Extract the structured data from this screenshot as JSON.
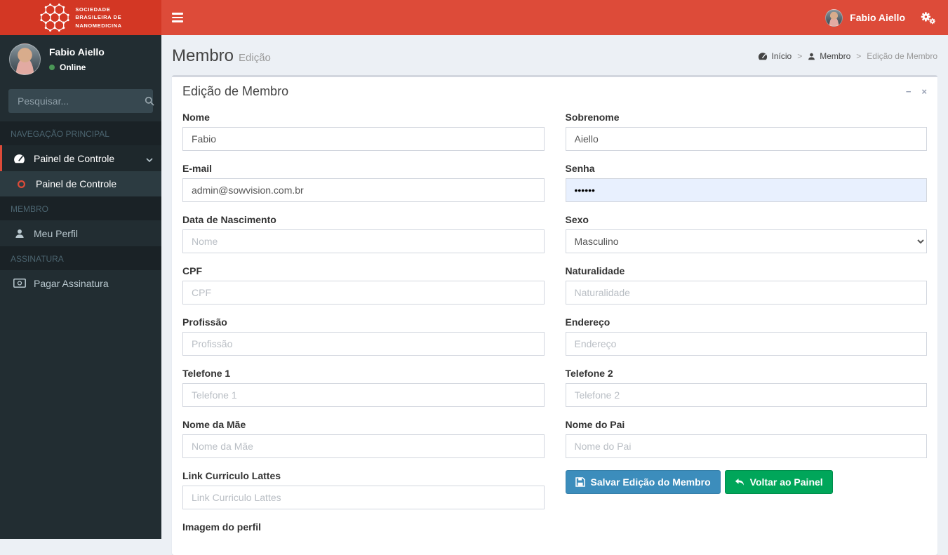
{
  "brand": {
    "line1": "SOCIEDADE",
    "line2": "BRASILEIRA DE",
    "line3": "NANOMEDICINA"
  },
  "navbar": {
    "user_name": "Fabio Aiello"
  },
  "sidebar": {
    "user": {
      "name": "Fabio Aiello",
      "status": "Online",
      "status_color": "#4a9656"
    },
    "search_placeholder": "Pesquisar...",
    "sections": [
      {
        "header": "NAVEGAÇÃO PRINCIPAL",
        "items": [
          {
            "label": "Painel de Controle",
            "icon": "tachometer-icon",
            "children": [
              {
                "label": "Painel de Controle",
                "icon": "circle-o-icon"
              }
            ]
          }
        ]
      },
      {
        "header": "MEMBRO",
        "items": [
          {
            "label": "Meu Perfil",
            "icon": "user-icon"
          }
        ]
      },
      {
        "header": "ASSINATURA",
        "items": [
          {
            "label": "Pagar Assinatura",
            "icon": "money-icon"
          }
        ]
      }
    ]
  },
  "page": {
    "title": "Membro",
    "subtitle": "Edição",
    "breadcrumb": [
      {
        "label": "Início",
        "icon": "tachometer-icon"
      },
      {
        "label": "Membro",
        "icon": "user-icon"
      },
      {
        "label": "Edição de Membro"
      }
    ]
  },
  "box": {
    "title": "Edição de Membro",
    "tools": {
      "collapse": "−",
      "close": "×"
    }
  },
  "form": {
    "nome": {
      "label": "Nome",
      "value": "Fabio"
    },
    "sobrenome": {
      "label": "Sobrenome",
      "value": "Aiello"
    },
    "email": {
      "label": "E-mail",
      "value": "admin@sowvision.com.br"
    },
    "senha": {
      "label": "Senha",
      "value": "••••••"
    },
    "data_nascimento": {
      "label": "Data de Nascimento",
      "placeholder": "Nome"
    },
    "sexo": {
      "label": "Sexo",
      "value": "Masculino"
    },
    "cpf": {
      "label": "CPF",
      "placeholder": "CPF"
    },
    "naturalidade": {
      "label": "Naturalidade",
      "placeholder": "Naturalidade"
    },
    "profissao": {
      "label": "Profissão",
      "placeholder": "Profissão"
    },
    "endereco": {
      "label": "Endereço",
      "placeholder": "Endereço"
    },
    "telefone1": {
      "label": "Telefone 1",
      "placeholder": "Telefone 1"
    },
    "telefone2": {
      "label": "Telefone 2",
      "placeholder": "Telefone 2"
    },
    "nome_mae": {
      "label": "Nome da Mãe",
      "placeholder": "Nome da Mãe"
    },
    "nome_pai": {
      "label": "Nome do Pai",
      "placeholder": "Nome do Pai"
    },
    "link_lattes": {
      "label": "Link Curriculo Lattes",
      "placeholder": "Link Curriculo Lattes"
    },
    "imagem_perfil": {
      "label": "Imagem do perfil"
    }
  },
  "buttons": {
    "save": "Salvar Edição do Membro",
    "back": "Voltar ao Painel"
  },
  "colors": {
    "navbar": "#dd4b39",
    "logo_bg": "#d33724",
    "sidebar_bg": "#222d32",
    "primary": "#3c8dbc",
    "success": "#00a65a",
    "content_bg": "#ecf0f5",
    "input_border": "#d2d6de",
    "autofill_bg": "#e8f0fe"
  }
}
